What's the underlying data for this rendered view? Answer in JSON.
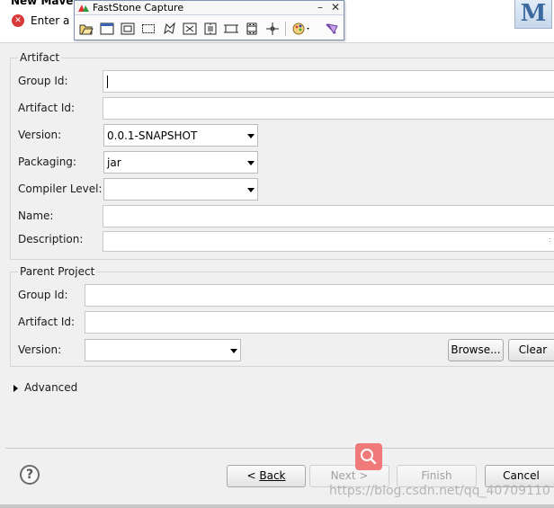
{
  "header": {
    "title": "New Maven",
    "message": "Enter a c",
    "logo_text": "M"
  },
  "faststone": {
    "title": "FastStone Capture",
    "minimize": "–",
    "close": "✕",
    "tools": [
      "open-icon",
      "window-capture-icon",
      "object-capture-icon",
      "rectangle-capture-icon",
      "freehand-capture-icon",
      "fullscreen-capture-icon",
      "scrolling-capture-icon",
      "fixed-region-icon",
      "video-capture-icon",
      "crosshair-icon",
      "palette-icon",
      "settings-icon"
    ]
  },
  "artifact": {
    "group_title": "Artifact",
    "group_id_label": "Group Id:",
    "group_id_value": "",
    "artifact_id_label": "Artifact Id:",
    "artifact_id_value": "",
    "version_label": "Version:",
    "version_value": "0.0.1-SNAPSHOT",
    "packaging_label": "Packaging:",
    "packaging_value": "jar",
    "compiler_label": "Compiler Level:",
    "compiler_value": "",
    "name_label": "Name:",
    "name_value": "",
    "description_label": "Description:",
    "description_value": ""
  },
  "parent": {
    "group_title": "Parent Project",
    "group_id_label": "Group Id:",
    "group_id_value": "",
    "artifact_id_label": "Artifact Id:",
    "artifact_id_value": "",
    "version_label": "Version:",
    "version_value": "",
    "browse_label": "Browse...",
    "clear_label": "Clear"
  },
  "advanced": {
    "label": "Advanced"
  },
  "footer": {
    "help": "?",
    "back_prefix": "< ",
    "back_label": "Back",
    "next_label": "Next >",
    "finish_label": "Finish",
    "cancel_label": "Cancel"
  },
  "watermark": "https://blog.csdn.net/qq_40709110",
  "colors": {
    "background": "#f0f0f0",
    "error": "#d83a3a",
    "search_overlay": "#f07a7a"
  }
}
